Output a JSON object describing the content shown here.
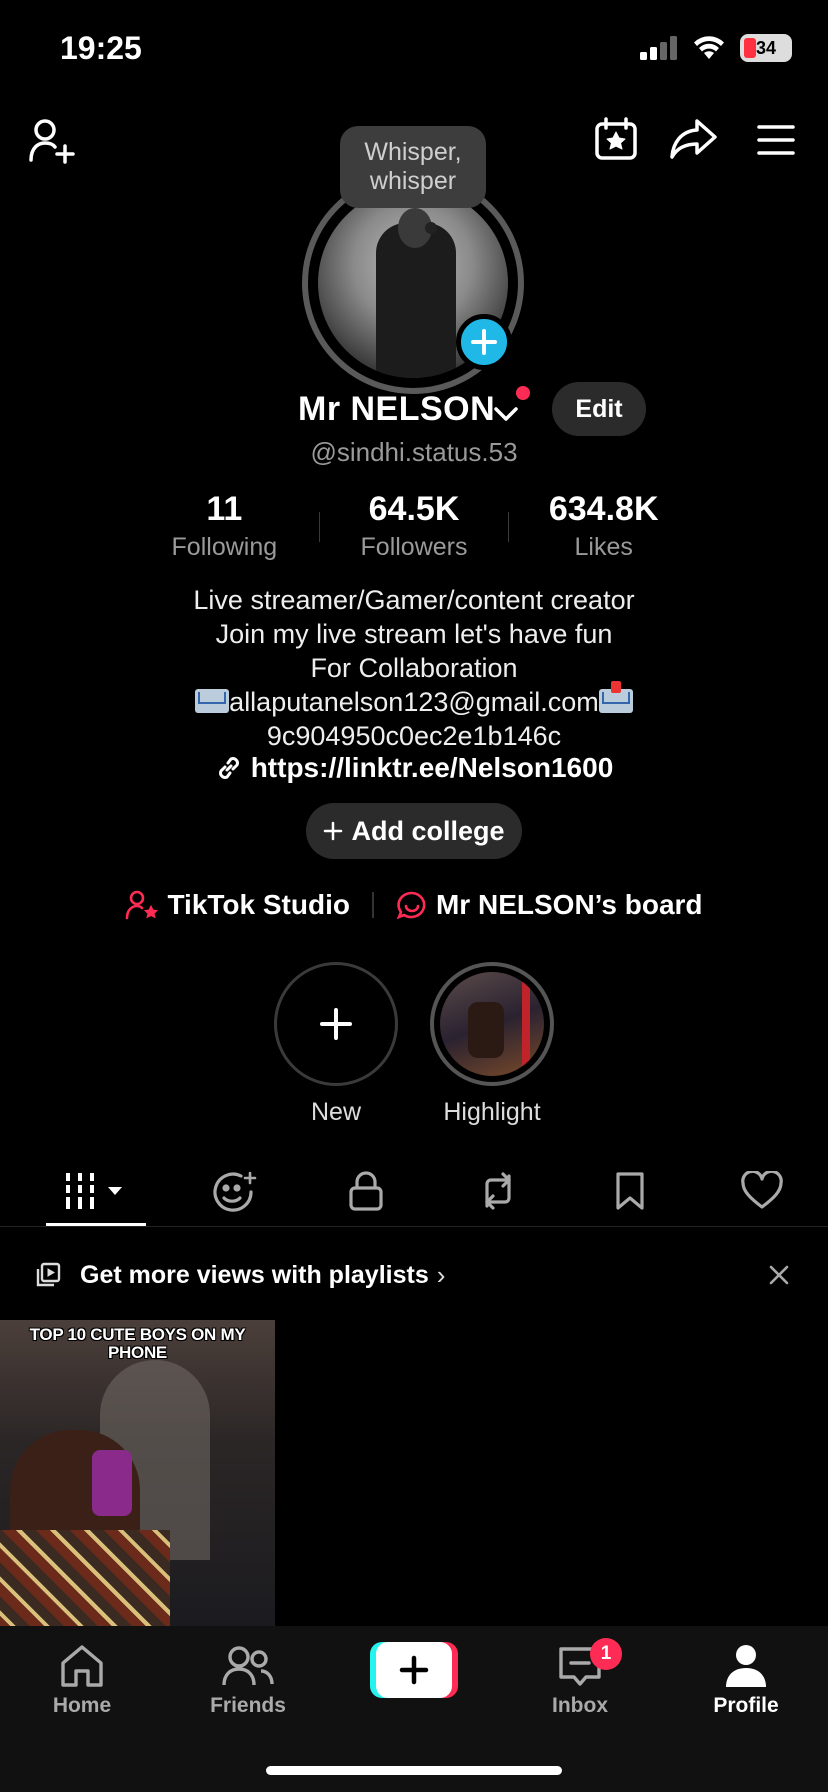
{
  "status_bar": {
    "time": "19:25",
    "battery": "34"
  },
  "avatar_tooltip": "Whisper, whisper",
  "profile": {
    "name": "Mr NELSON",
    "edit_label": "Edit",
    "username": "@sindhi.status.53"
  },
  "stats": [
    {
      "value": "11",
      "label": "Following"
    },
    {
      "value": "64.5K",
      "label": "Followers"
    },
    {
      "value": "634.8K",
      "label": "Likes"
    }
  ],
  "bio": {
    "line1": "Live streamer/Gamer/content creator",
    "line2": "Join my live stream let's have fun",
    "line3": "For Collaboration",
    "email": "allaputanelson123@gmail.com",
    "line5": "9c904950c0ec2e1b146c",
    "link": "https://linktr.ee/Nelson1600"
  },
  "add_college_label": "Add college",
  "links": {
    "studio": "TikTok Studio",
    "board": "Mr NELSON’s board"
  },
  "highlights": [
    {
      "label": "New"
    },
    {
      "label": "Highlight"
    }
  ],
  "tabs": [
    {
      "icon": "videos-grid-icon",
      "active": true
    },
    {
      "icon": "reposts-face-icon",
      "active": false
    },
    {
      "icon": "lock-icon",
      "active": false
    },
    {
      "icon": "repost-icon",
      "active": false
    },
    {
      "icon": "bookmark-icon",
      "active": false
    },
    {
      "icon": "heart-icon",
      "active": false
    }
  ],
  "playlist_banner": {
    "text": "Get more views with playlists",
    "chevron": "›"
  },
  "videos": [
    {
      "caption": "TOP 10 CUTE BOYS ON MY PHONE"
    }
  ],
  "bottom_nav": {
    "home": "Home",
    "friends": "Friends",
    "inbox": "Inbox",
    "inbox_badge": "1",
    "profile": "Profile"
  },
  "colors": {
    "accent_red": "#fe2c55",
    "accent_cyan": "#25f4ee",
    "avatar_plus": "#20b8e6"
  }
}
